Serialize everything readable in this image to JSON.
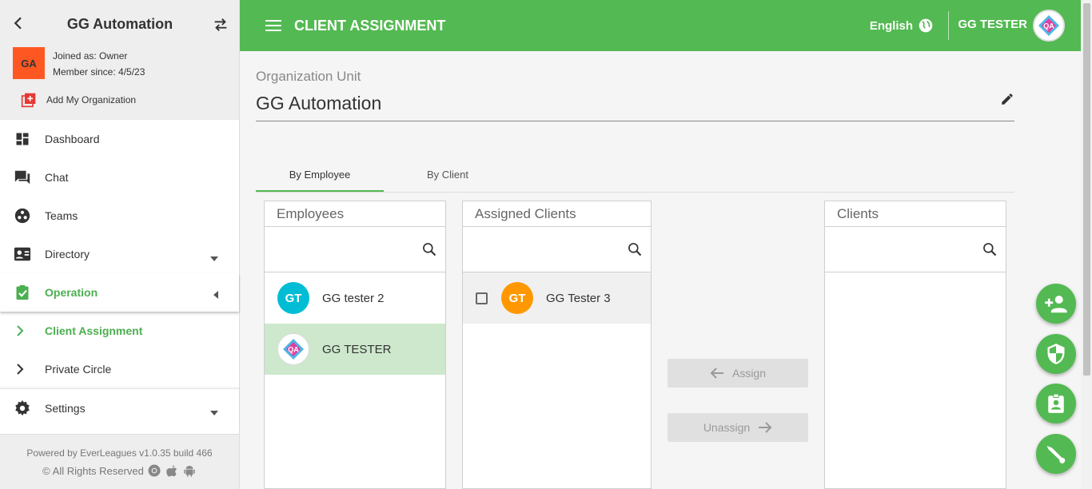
{
  "sidebar": {
    "org_title": "GG Automation",
    "avatar_initials": "GA",
    "joined_as": "Joined as: Owner",
    "member_since": "Member since: 4/5/23",
    "add_org_label": "Add My Organization",
    "nav": [
      {
        "label": "Dashboard",
        "icon": "dashboard-icon"
      },
      {
        "label": "Chat",
        "icon": "chat-icon"
      },
      {
        "label": "Teams",
        "icon": "teams-icon"
      },
      {
        "label": "Directory",
        "icon": "directory-icon"
      },
      {
        "label": "Operation",
        "icon": "operation-icon"
      }
    ],
    "sub_items": [
      {
        "label": "Client Assignment"
      },
      {
        "label": "Private Circle"
      }
    ],
    "settings_label": "Settings",
    "footer_line1": "Powered by EverLeagues v1.0.35 build 466",
    "footer_line2": "© All Rights Reserved"
  },
  "header": {
    "title": "CLIENT ASSIGNMENT",
    "language": "English",
    "user_name": "GG TESTER"
  },
  "main": {
    "org_unit_label": "Organization Unit",
    "org_unit_value": "GG Automation",
    "tabs": [
      {
        "label": "By Employee"
      },
      {
        "label": "By Client"
      }
    ],
    "employees": {
      "title": "Employees",
      "search_placeholder": "",
      "items": [
        {
          "initials": "GT",
          "name": "GG tester 2"
        },
        {
          "initials": "",
          "name": "GG TESTER"
        }
      ]
    },
    "assigned_clients": {
      "title": "Assigned Clients",
      "search_placeholder": "",
      "items": [
        {
          "initials": "GT",
          "name": "GG Tester 3"
        }
      ]
    },
    "clients": {
      "title": "Clients",
      "search_placeholder": ""
    },
    "assign_label": "Assign",
    "unassign_label": "Unassign"
  },
  "colors": {
    "brand_green": "#53b952",
    "selected_row": "#cde8cc",
    "avatar_teal": "#00bcd4",
    "avatar_orange": "#ff9800",
    "org_avatar": "#ff5722"
  }
}
